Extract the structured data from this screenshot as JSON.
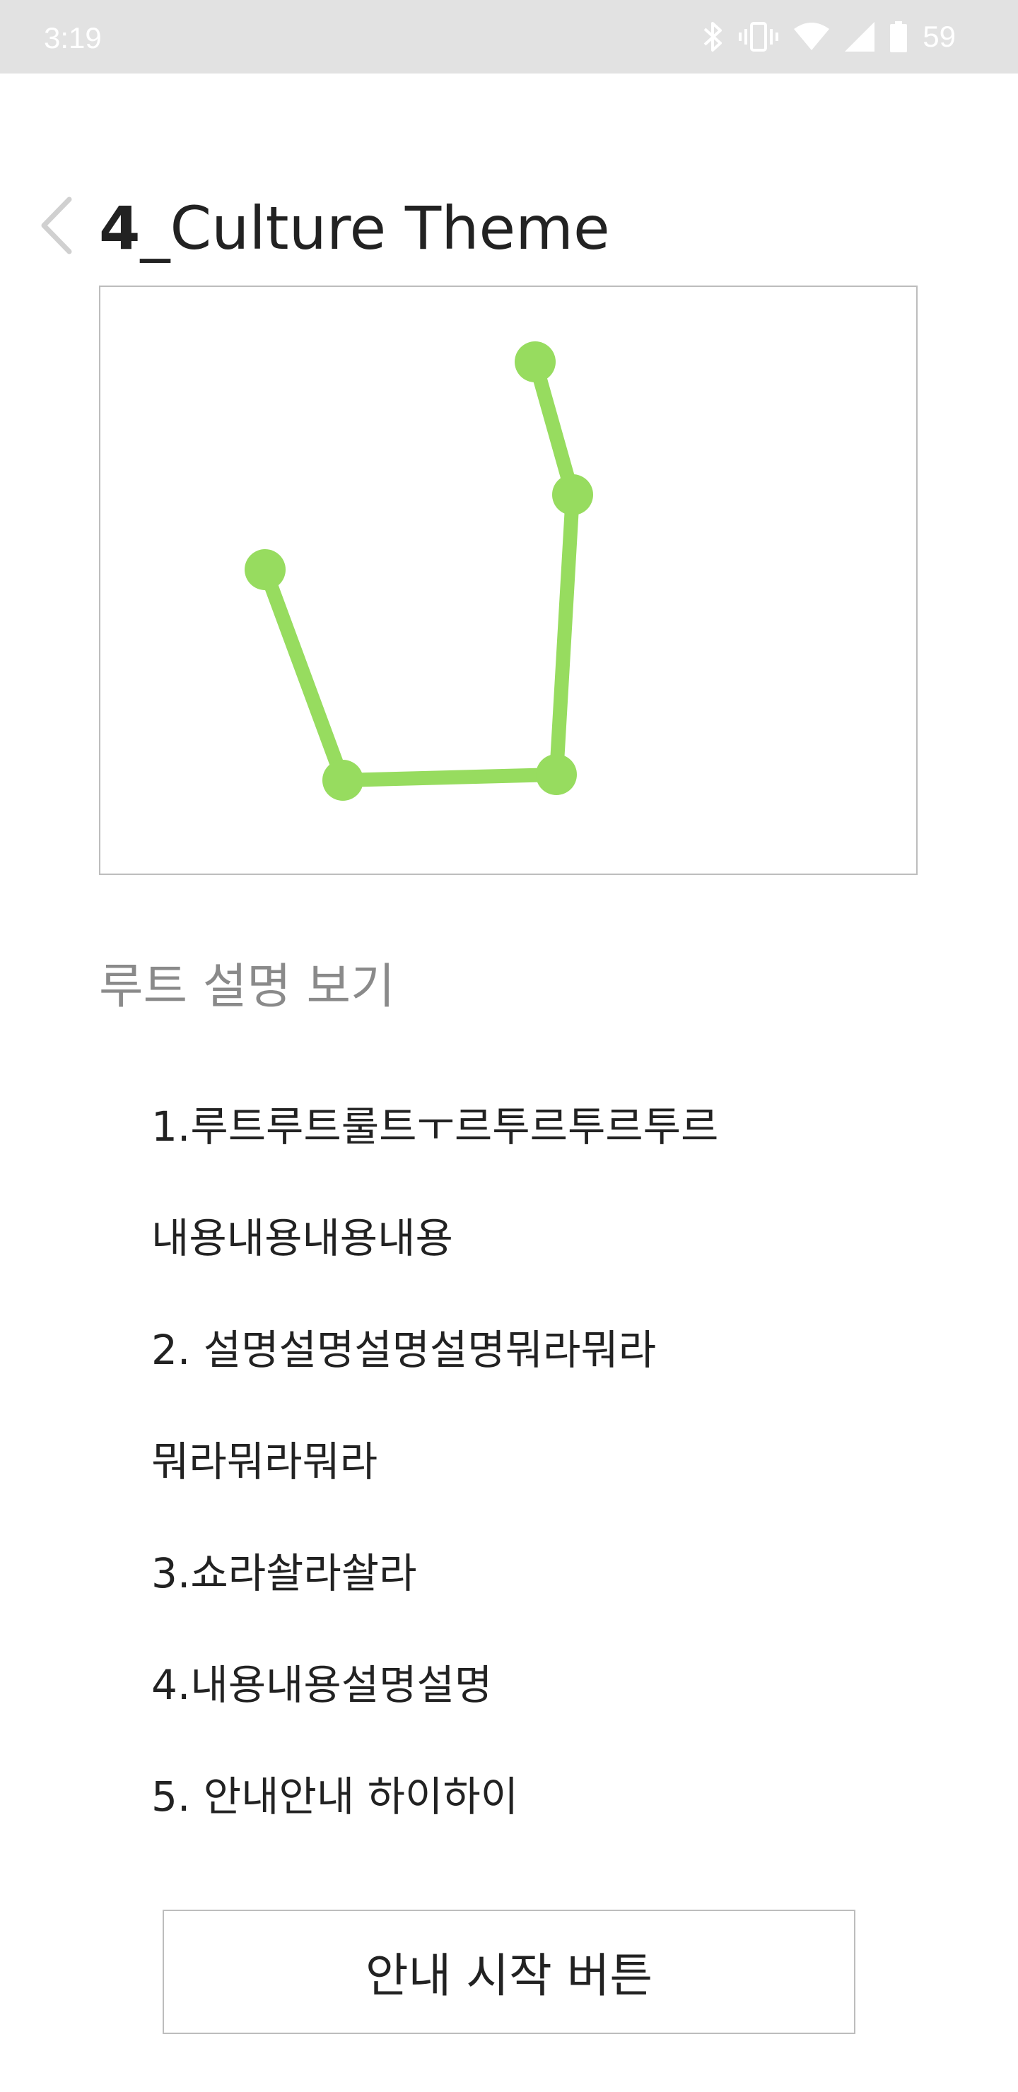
{
  "status_bar": {
    "time": "3:19",
    "battery_percent": "59",
    "icons": [
      "bluetooth-icon",
      "vibrate-icon",
      "wifi-icon",
      "signal-icon",
      "battery-icon"
    ]
  },
  "header": {
    "back_icon": "chevron-left-icon",
    "title_number": "4",
    "title_text": "_Culture Theme"
  },
  "route_map": {
    "line_color": "#97dc5f",
    "border_color": "#bdbdbd"
  },
  "description": {
    "heading": "루트 설명 보기",
    "items": [
      "1.루트루트룰트ㅜ르투르투르투르",
      "내용내용내용내용",
      "2. 설명설명설명설명뭐라뭐라",
      "뭐라뭐라뭐라",
      "3.쇼라솰라솰라",
      "4.내용내용설명설명",
      "5. 안내안내 하이하이"
    ]
  },
  "start_button": {
    "label": "안내 시작 버튼"
  }
}
